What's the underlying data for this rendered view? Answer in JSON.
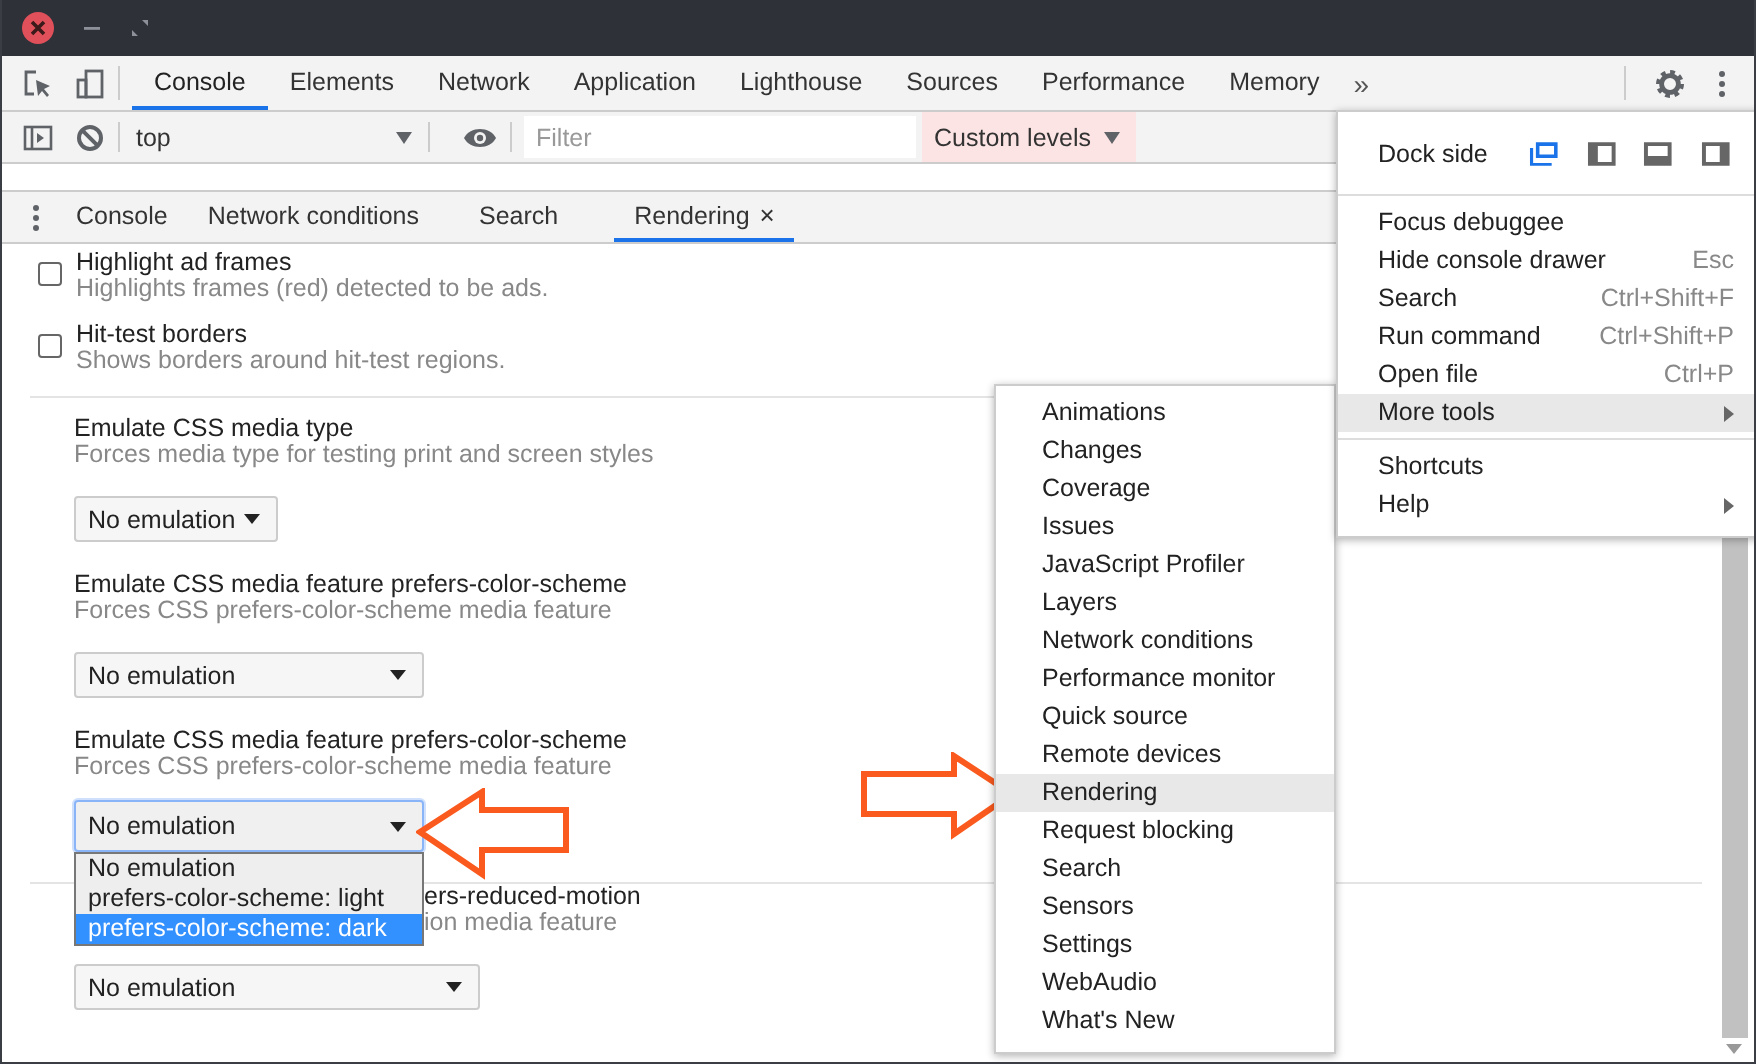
{
  "main_tabs": [
    {
      "label": "Console",
      "selected": true
    },
    {
      "label": "Elements",
      "selected": false
    },
    {
      "label": "Network",
      "selected": false
    },
    {
      "label": "Application",
      "selected": false
    },
    {
      "label": "Lighthouse",
      "selected": false
    },
    {
      "label": "Sources",
      "selected": false
    },
    {
      "label": "Performance",
      "selected": false
    },
    {
      "label": "Memory",
      "selected": false
    }
  ],
  "tabs_overflow": "»",
  "console_toolbar": {
    "context": "top",
    "filter_placeholder": "Filter",
    "levels": "Custom levels"
  },
  "drawer_tabs": [
    {
      "label": "Console",
      "selected": false
    },
    {
      "label": "Network conditions",
      "selected": false
    },
    {
      "label": "Search",
      "selected": false
    },
    {
      "label": "Rendering",
      "selected": true,
      "close": "×"
    }
  ],
  "settings": [
    {
      "kind": "checkbox",
      "title": "Highlight ad frames",
      "description": "Highlights frames (red) detected to be ads.",
      "checked": false
    },
    {
      "kind": "checkbox",
      "title": "Hit-test borders",
      "description": "Shows borders around hit-test regions.",
      "checked": false
    },
    {
      "kind": "select",
      "title": "Emulate CSS media type",
      "description": "Forces media type for testing print and screen styles",
      "value": "No emulation",
      "open": false
    },
    {
      "kind": "select",
      "title": "Emulate CSS media feature prefers-color-scheme",
      "description": "Forces CSS prefers-color-scheme media feature",
      "value": "No emulation",
      "open": false
    },
    {
      "kind": "select",
      "title": "Emulate CSS media feature prefers-color-scheme",
      "description": "Forces CSS prefers-color-scheme media feature",
      "value": "No emulation",
      "open": true,
      "options": [
        {
          "label": "No emulation",
          "highlighted": false
        },
        {
          "label": "prefers-color-scheme: light",
          "highlighted": false
        },
        {
          "label": "prefers-color-scheme: dark",
          "highlighted": true
        }
      ]
    },
    {
      "kind": "select",
      "title": "ers-reduced-motion",
      "description": "ion media feature",
      "value": "No emulation",
      "open": false,
      "partly_hidden": true
    }
  ],
  "main_menu": {
    "dock_label": "Dock side",
    "dock_options": [
      {
        "kind": "undock",
        "selected": true
      },
      {
        "kind": "left",
        "selected": false
      },
      {
        "kind": "bottom",
        "selected": false
      },
      {
        "kind": "right",
        "selected": false
      }
    ],
    "groups": [
      [
        {
          "label": "Focus debuggee",
          "highlighted": false,
          "submenu": false
        },
        {
          "label": "Hide console drawer",
          "shortcut": "Esc",
          "highlighted": false,
          "submenu": false
        },
        {
          "label": "Search",
          "shortcut": "Ctrl+Shift+F",
          "highlighted": false,
          "submenu": false
        },
        {
          "label": "Run command",
          "shortcut": "Ctrl+Shift+P",
          "highlighted": false,
          "submenu": false
        },
        {
          "label": "Open file",
          "shortcut": "Ctrl+P",
          "highlighted": false,
          "submenu": false
        },
        {
          "label": "More tools",
          "highlighted": true,
          "submenu": true
        }
      ],
      [
        {
          "label": "Shortcuts",
          "highlighted": false,
          "submenu": false
        },
        {
          "label": "Help",
          "highlighted": false,
          "submenu": true
        }
      ]
    ]
  },
  "more_tools_menu": [
    {
      "label": "Animations",
      "highlighted": false
    },
    {
      "label": "Changes",
      "highlighted": false
    },
    {
      "label": "Coverage",
      "highlighted": false
    },
    {
      "label": "Issues",
      "highlighted": false
    },
    {
      "label": "JavaScript Profiler",
      "highlighted": false
    },
    {
      "label": "Layers",
      "highlighted": false
    },
    {
      "label": "Network conditions",
      "highlighted": false
    },
    {
      "label": "Performance monitor",
      "highlighted": false
    },
    {
      "label": "Quick source",
      "highlighted": false
    },
    {
      "label": "Remote devices",
      "highlighted": false
    },
    {
      "label": "Rendering",
      "highlighted": true
    },
    {
      "label": "Request blocking",
      "highlighted": false
    },
    {
      "label": "Search",
      "highlighted": false
    },
    {
      "label": "Sensors",
      "highlighted": false
    },
    {
      "label": "Settings",
      "highlighted": false
    },
    {
      "label": "WebAudio",
      "highlighted": false
    },
    {
      "label": "What's New",
      "highlighted": false
    }
  ]
}
